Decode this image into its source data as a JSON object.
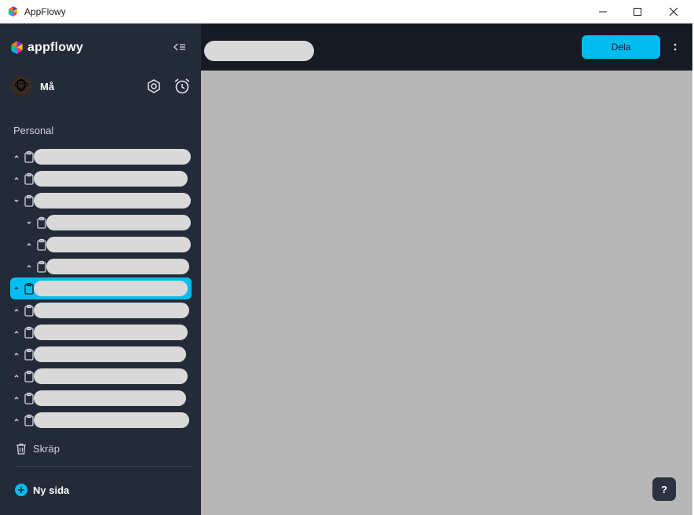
{
  "window": {
    "title": "AppFlowy"
  },
  "sidebar": {
    "logo_text": "appflowy",
    "user": {
      "name": "Må"
    },
    "section_title": "Personal",
    "pages": [
      {
        "label": "",
        "expanded": false,
        "level": 0,
        "selected": false
      },
      {
        "label": "",
        "expanded": false,
        "level": 0,
        "selected": false
      },
      {
        "label": "",
        "expanded": true,
        "level": 0,
        "selected": false
      },
      {
        "label": "",
        "expanded": true,
        "level": 1,
        "selected": false
      },
      {
        "label": "",
        "expanded": false,
        "level": 1,
        "selected": false
      },
      {
        "label": "",
        "expanded": false,
        "level": 1,
        "selected": false
      },
      {
        "label": "",
        "expanded": false,
        "level": 0,
        "selected": true
      },
      {
        "label": "",
        "expanded": false,
        "level": 0,
        "selected": false
      },
      {
        "label": "",
        "expanded": false,
        "level": 0,
        "selected": false
      },
      {
        "label": "",
        "expanded": false,
        "level": 0,
        "selected": false
      },
      {
        "label": "",
        "expanded": false,
        "level": 0,
        "selected": false
      },
      {
        "label": "",
        "expanded": false,
        "level": 0,
        "selected": false
      },
      {
        "label": "",
        "expanded": false,
        "level": 0,
        "selected": false
      }
    ],
    "trash_label": "Skräp",
    "new_page_label": "Ny sida"
  },
  "topbar": {
    "breadcrumb": "",
    "share_label": "Dela",
    "more_label": "⋮"
  },
  "help_label": "?",
  "icons": {
    "app": "appflowy-logo-icon",
    "collapse": "collapse-sidebar-icon",
    "settings": "settings-icon",
    "alarm": "alarm-clock-icon",
    "page": "document-icon",
    "trash": "trash-icon",
    "add": "plus-circle-icon"
  },
  "colors": {
    "sidebar_bg": "#232b38",
    "topbar_bg": "#161a23",
    "accent": "#00bcf0",
    "content_bg": "#b7b7b7"
  }
}
